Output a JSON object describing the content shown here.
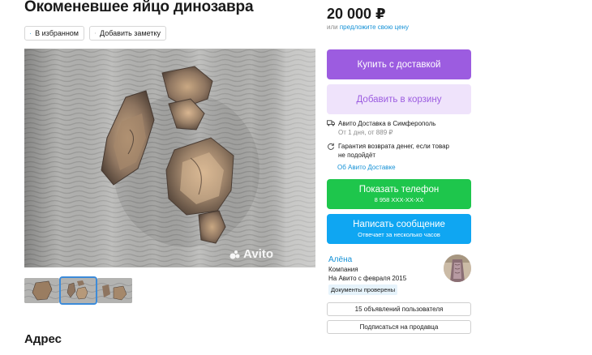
{
  "listing": {
    "title": "Окоменевшее яйцо динозавра",
    "favorite_label": "В избранном",
    "note_label": "Добавить заметку",
    "watermark": "Avito",
    "section_address": "Адрес",
    "thumbnails": [
      "photo-1",
      "photo-2",
      "photo-3"
    ],
    "selected_thumbnail": 2
  },
  "sidebar": {
    "price": "20 000 ₽",
    "offer_prefix": "или",
    "offer_link": "предложите свою цену",
    "buy_label": "Купить с доставкой",
    "cart_label": "Добавить в корзину",
    "delivery_title": "Авито Доставка в Симферополь",
    "delivery_sub": "От 1 дня, от 889 ₽",
    "guarantee_line1": "Гарантия возврата денег, если товар",
    "guarantee_line2": "не подойдёт",
    "about_delivery_link": "Об Авито Доставке",
    "phone_label": "Показать телефон",
    "phone_number": "8 958 XXX-XX-XX",
    "message_label": "Написать сообщение",
    "message_sub": "Отвечает за несколько часов",
    "seller_name": "Алёна",
    "seller_type": "Компания",
    "seller_since": "На Авито с февраля 2015",
    "docs_badge": "Документы проверены",
    "listings_button": "15 объявлений пользователя",
    "subscribe_button": "Подписаться на продавца"
  },
  "icons": {
    "favorite": "heart-icon",
    "note": "note-icon",
    "delivery": "truck-icon",
    "guarantee": "refresh-icon"
  },
  "colors": {
    "buy": "#9c5ce0",
    "cart_bg": "#efe3fb",
    "phone": "#1ec64c",
    "message": "#0fa6f2",
    "link": "#1591d6",
    "favorite_heart": "#1591d6"
  }
}
